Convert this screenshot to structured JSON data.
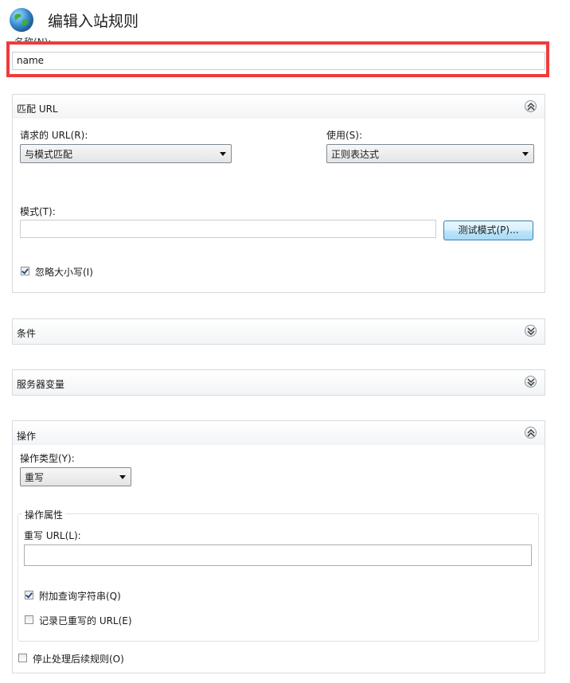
{
  "header": {
    "title": "编辑入站规则",
    "icon": "globe-icon"
  },
  "name": {
    "label": "名称(N):",
    "value": "name"
  },
  "match_url": {
    "title": "匹配 URL",
    "requested_url_label": "请求的 URL(R):",
    "requested_url_value": "与模式匹配",
    "using_label": "使用(S):",
    "using_value": "正则表达式",
    "pattern_label": "模式(T):",
    "pattern_value": "",
    "test_button": "测试模式(P)...",
    "ignore_case_label": "忽略大小写(I)",
    "ignore_case_checked": true
  },
  "conditions": {
    "title": "条件"
  },
  "server_variables": {
    "title": "服务器变量"
  },
  "action": {
    "title": "操作",
    "type_label": "操作类型(Y):",
    "type_value": "重写",
    "properties_legend": "操作属性",
    "rewrite_url_label": "重写 URL(L):",
    "rewrite_url_value": "",
    "append_query_label": "附加查询字符串(Q)",
    "append_query_checked": true,
    "log_rewritten_label": "记录已重写的 URL(E)",
    "log_rewritten_checked": false,
    "stop_processing_label": "停止处理后续规则(O)",
    "stop_processing_checked": false
  },
  "colors": {
    "highlight": "#ef3b3b",
    "button_border": "#3c7fb1"
  }
}
